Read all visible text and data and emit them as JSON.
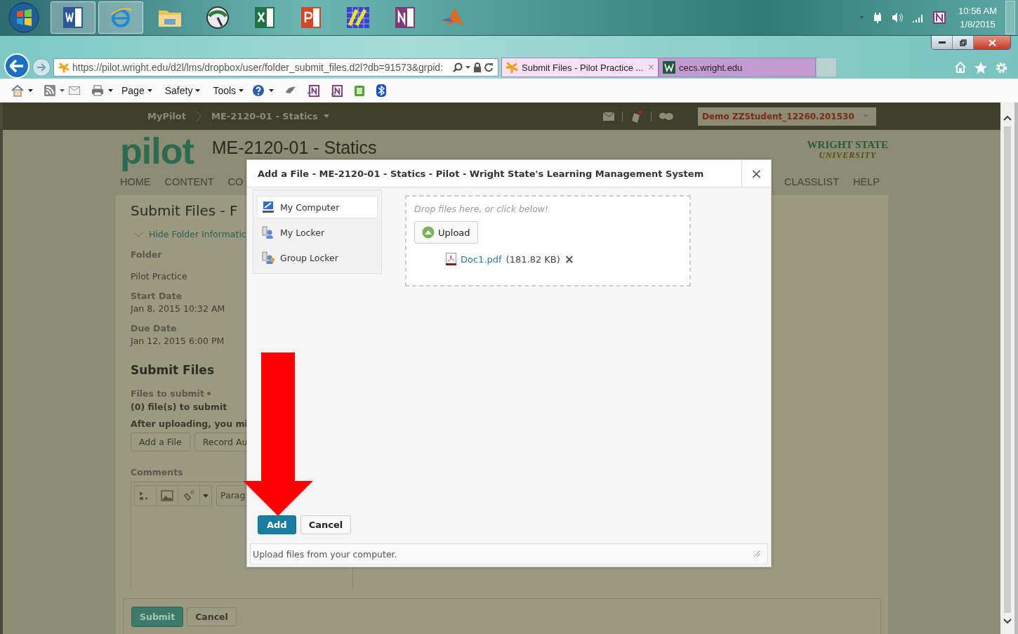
{
  "taskbar": {
    "clock": {
      "time": "10:56 AM",
      "date": "1/8/2015"
    }
  },
  "browser": {
    "url": "https://pilot.wright.edu/d2l/lms/dropbox/user/folder_submit_files.d2l?db=91573&grpid:",
    "tabs": [
      {
        "title": "Submit Files - Pilot Practice ...",
        "close": "×",
        "selected": true
      },
      {
        "title": "cecs.wright.edu",
        "selected": false
      }
    ],
    "menus": [
      "Page",
      "Safety",
      "Tools"
    ]
  },
  "site": {
    "breadcrumbs": [
      "MyPilot",
      "ME-2120-01 - Statics"
    ],
    "user": "Demo ZZStudent_12260.201530",
    "logo": "pilot",
    "course_title": "ME-2120-01 - Statics",
    "university": [
      "WRIGHT STATE",
      "UNIVERSITY"
    ],
    "nav_left": [
      "HOME",
      "CONTENT",
      "CO"
    ],
    "nav_right": [
      "CLASSLIST",
      "HELP"
    ]
  },
  "page": {
    "title": "Submit Files - F",
    "toggle": "Hide Folder Informatic",
    "fields": [
      {
        "label": "Folder",
        "value": "Pilot Practice"
      },
      {
        "label": "Start Date",
        "value": "Jan 8, 2015 10:32 AM"
      },
      {
        "label": "Due Date",
        "value": "Jan 12, 2015 6:00 PM"
      }
    ],
    "section": "Submit Files",
    "files_label": "Files to submit",
    "files_count": "(0) file(s) to submit",
    "after_upload": "After uploading, you mi",
    "file_buttons": [
      "Add a File",
      "Record Au"
    ],
    "comments_label": "Comments",
    "format_select": "Parag",
    "actions": [
      "Submit",
      "Cancel"
    ]
  },
  "dialog": {
    "title": "Add a File - ME-2120-01 - Statics - Pilot - Wright State's Learning Management System",
    "close": "×",
    "sources": [
      {
        "label": "My Computer",
        "selected": true
      },
      {
        "label": "My Locker",
        "selected": false
      },
      {
        "label": "Group Locker",
        "selected": false
      }
    ],
    "drop_hint": "Drop files here, or click below!",
    "upload": "Upload",
    "file": {
      "name": "Doc1.pdf",
      "size": "(181.82 KB)",
      "remove": "×"
    },
    "buttons": [
      "Add",
      "Cancel"
    ],
    "status": "Upload files from your computer."
  }
}
